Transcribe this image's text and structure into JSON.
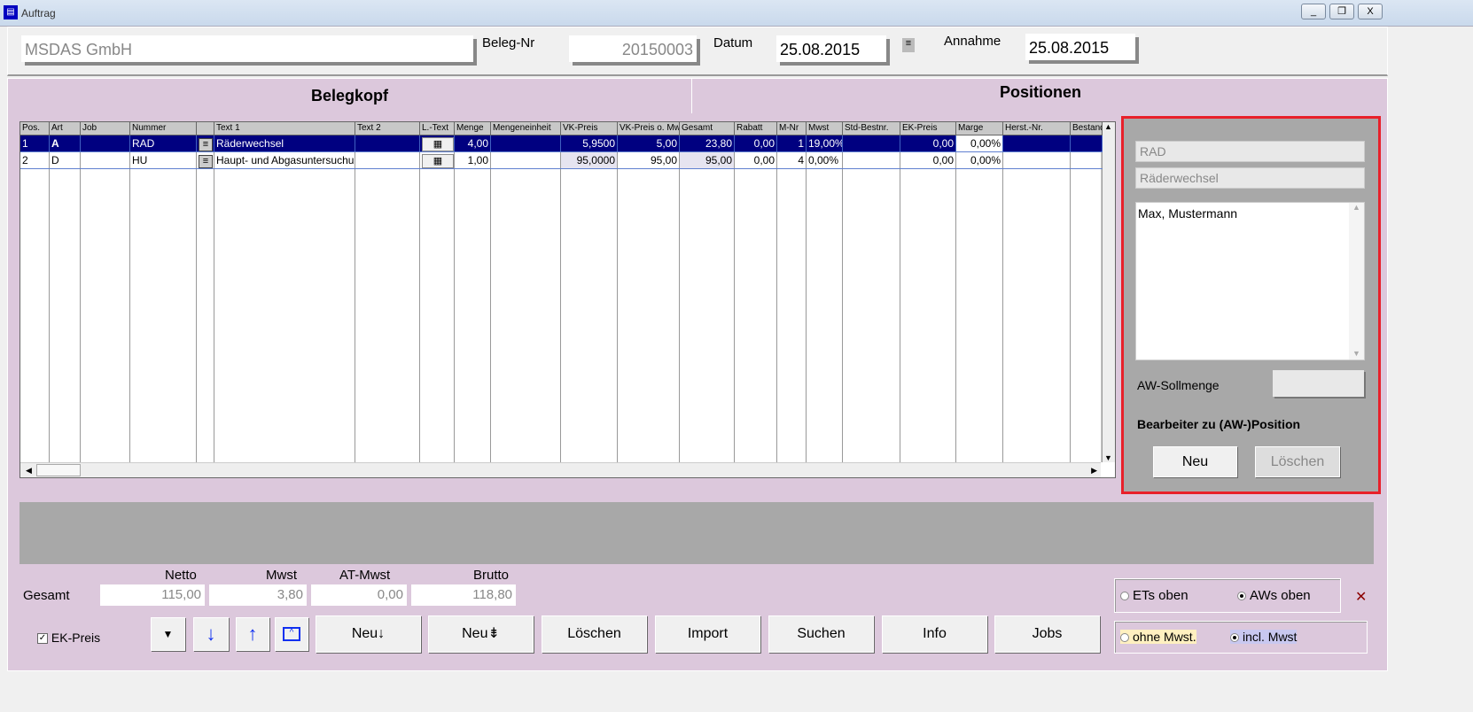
{
  "window": {
    "title": "Auftrag",
    "minimize": "_",
    "restore": "❐",
    "close": "X"
  },
  "header": {
    "customer": "MSDAS GmbH",
    "beleg_label": "Beleg-Nr",
    "beleg_nr": "20150003",
    "datum_label": "Datum",
    "datum": "25.08.2015",
    "annahme_label": "Annahme",
    "annahme": "25.08.2015"
  },
  "tabs": [
    {
      "label": "Belegkopf"
    },
    {
      "label": "Positionen",
      "active": true
    }
  ],
  "grid": {
    "columns": [
      "Pos.",
      "Art",
      "Job",
      "Nummer",
      "",
      "Text 1",
      "Text 2",
      "L.-Text",
      "Menge",
      "Mengeneinheit",
      "VK-Preis",
      "VK-Preis o. Mwst",
      "Gesamt",
      "Rabatt",
      "M-Nr",
      "Mwst",
      "Std-Bestnr.",
      "EK-Preis",
      "Marge",
      "Herst.-Nr.",
      "Bestand"
    ],
    "rows": [
      [
        "1",
        "A",
        "",
        "RAD",
        "",
        "Räderwechsel",
        "",
        "",
        "4,00",
        "",
        "5,9500",
        "5,00",
        "23,80",
        "0,00",
        "1",
        "19,00%",
        "",
        "0,00",
        "0,00%",
        "",
        ""
      ],
      [
        "2",
        "D",
        "",
        "HU",
        "",
        "Haupt- und Abgasuntersuchung",
        "",
        "",
        "1,00",
        "",
        "95,0000",
        "95,00",
        "95,00",
        "0,00",
        "4",
        "0,00%",
        "",
        "0,00",
        "0,00%",
        "",
        ""
      ]
    ],
    "selected_row": 0
  },
  "detail": {
    "nummer": "RAD",
    "text": "Räderwechsel",
    "bearbeiter": "Max, Mustermann",
    "aw_label": "AW-Sollmenge",
    "aw_value": "",
    "bearbeiter_title": "Bearbeiter zu (AW-)Position",
    "neu": "Neu",
    "loeschen": "Löschen"
  },
  "totals": {
    "label": "Gesamt",
    "netto_label": "Netto",
    "netto": "115,00",
    "mwst_label": "Mwst",
    "mwst": "3,80",
    "at_label": "AT-Mwst",
    "at": "0,00",
    "brutto_label": "Brutto",
    "brutto": "118,80"
  },
  "toolbar": {
    "ek_preis": "EK-Preis",
    "ek_checked": true,
    "neu_down": "Neu↓",
    "neu_split": "Neu⇟",
    "loeschen": "Löschen",
    "import": "Import",
    "suchen": "Suchen",
    "info": "Info",
    "jobs": "Jobs"
  },
  "options": {
    "ets_oben": "ETs oben",
    "aws_oben": "AWs oben",
    "sort_selected": "AWs oben",
    "ohne_mwst": "ohne Mwst.",
    "incl_mwst": "incl. Mwst",
    "mwst_selected": "incl. Mwst",
    "close": "✕"
  },
  "colors": {
    "selection": "#000080",
    "panel": "#dcc8dc",
    "highlight_border": "#e8202a"
  }
}
